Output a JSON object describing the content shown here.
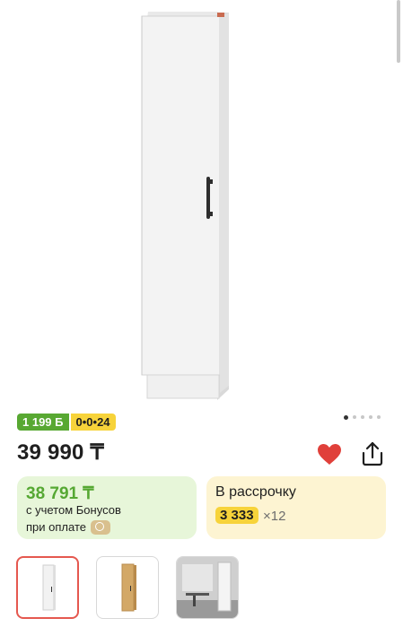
{
  "badges": {
    "bonus": "1 199 Б",
    "installment": "0•0•24"
  },
  "price": "39 990 ₸",
  "bonus_card": {
    "price": "38 791 ₸",
    "line1": "с учетом Бонусов",
    "line2": "при оплате"
  },
  "installment_card": {
    "title": "В рассрочку",
    "amount": "3 333",
    "months": "×12"
  },
  "gallery": {
    "active_index": 0,
    "total": 5
  },
  "icons": {
    "favorite": "heart-icon",
    "share": "share-icon",
    "bonus_coin": "bonus-coin-icon"
  },
  "colors": {
    "accent_green": "#58a832",
    "accent_yellow": "#f7d33a",
    "heart_red": "#e0403a"
  }
}
